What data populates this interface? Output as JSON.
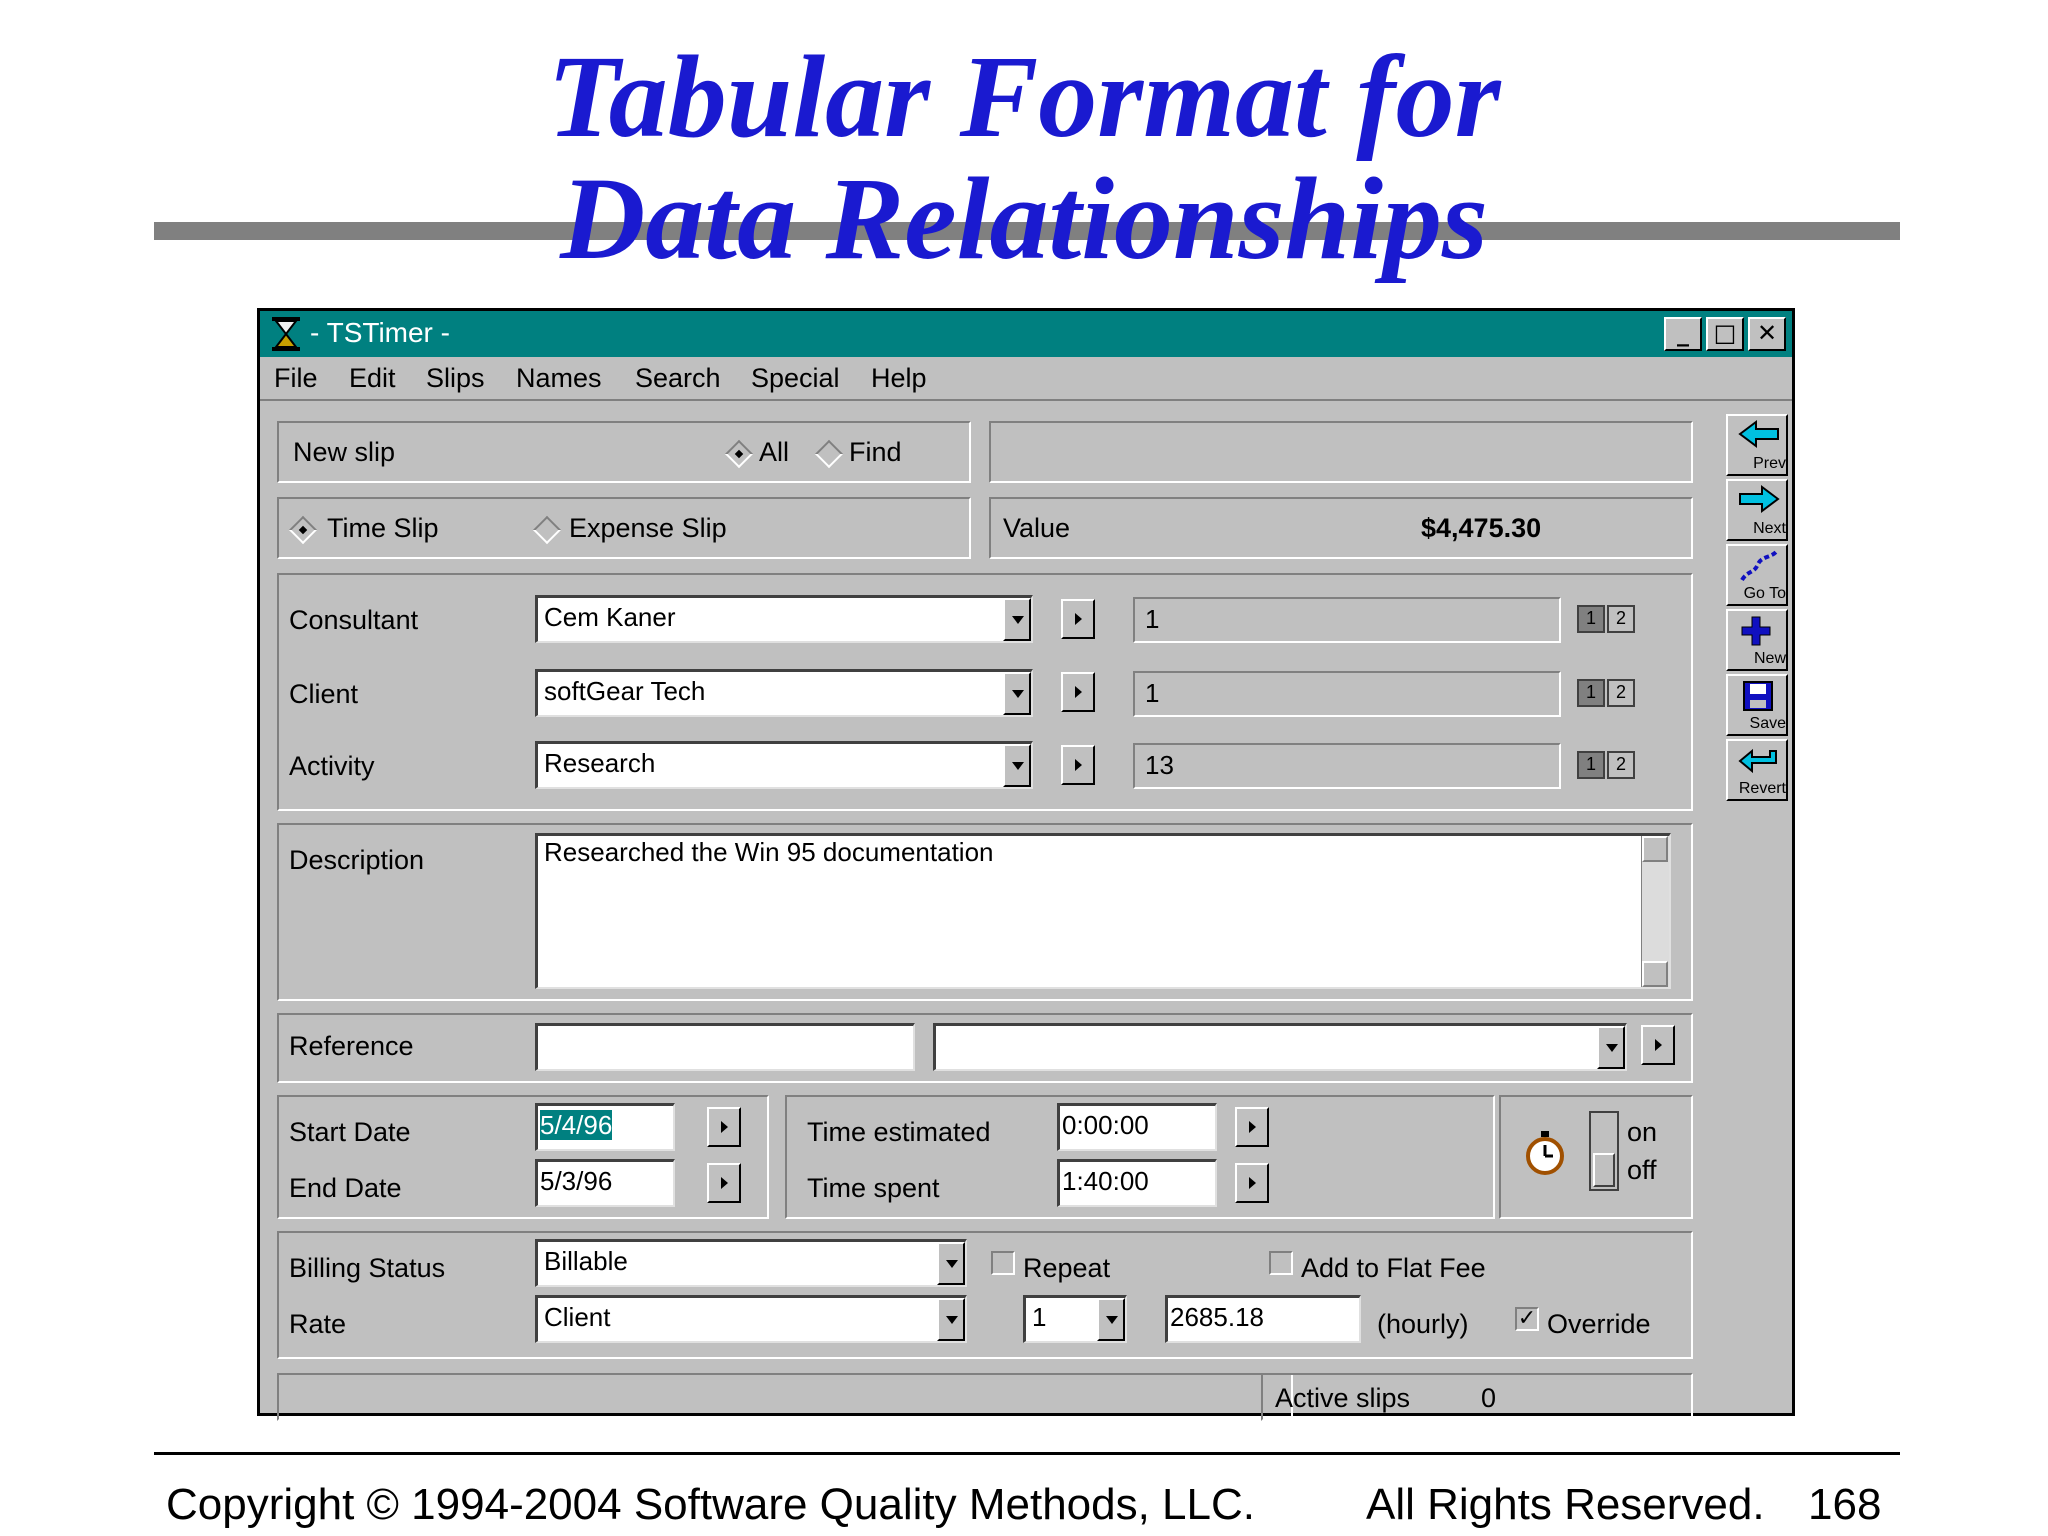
{
  "slide": {
    "title_line1": "Tabular Format for",
    "title_line2": "Data Relationships",
    "copyright": "Copyright © 1994-2004 Software Quality Methods, LLC.",
    "rights": "All Rights Reserved.",
    "page_number": "168"
  },
  "window": {
    "title": "- TSTimer -",
    "min_label": "_",
    "max_label": "□",
    "close_label": "✕"
  },
  "menu": [
    "File",
    "Edit",
    "Slips",
    "Names",
    "Search",
    "Special",
    "Help"
  ],
  "top": {
    "new_slip": "New slip",
    "all_label": "All",
    "find_label": "Find",
    "time_slip": "Time Slip",
    "expense_slip": "Expense Slip",
    "value_label": "Value",
    "value": "$4,475.30"
  },
  "fields": {
    "consultant_label": "Consultant",
    "consultant": "Cem Kaner",
    "consultant_id": "1",
    "client_label": "Client",
    "client": "softGear Tech",
    "client_id": "1",
    "activity_label": "Activity",
    "activity": "Research",
    "activity_id": "13",
    "toggle_1": "1",
    "toggle_2": "2",
    "description_label": "Description",
    "description": "Researched the Win 95 documentation",
    "reference_label": "Reference",
    "reference": "",
    "reference_select": ""
  },
  "dates": {
    "start_label": "Start Date",
    "start": "5/4/96",
    "end_label": "End Date",
    "end": "5/3/96",
    "time_est_label": "Time estimated",
    "time_est": "0:00:00",
    "time_spent_label": "Time spent",
    "time_spent": "1:40:00",
    "on_label": "on",
    "off_label": "off"
  },
  "billing": {
    "status_label": "Billing Status",
    "status": "Billable",
    "repeat_label": "Repeat",
    "flatfee_label": "Add to Flat Fee",
    "rate_label": "Rate",
    "rate": "Client",
    "rate_num": "1",
    "amount": "2685.18",
    "hourly": "(hourly)",
    "override_label": "Override",
    "override_check": "✓"
  },
  "status": {
    "active_label": "Active slips",
    "active_count": "0"
  },
  "toolbar": [
    "Prev",
    "Next",
    "Go To",
    "New",
    "Save",
    "Revert"
  ],
  "colors": {
    "titlebar": "#008080",
    "face": "#c0c0c0",
    "title_text": "#1a1ad0"
  }
}
